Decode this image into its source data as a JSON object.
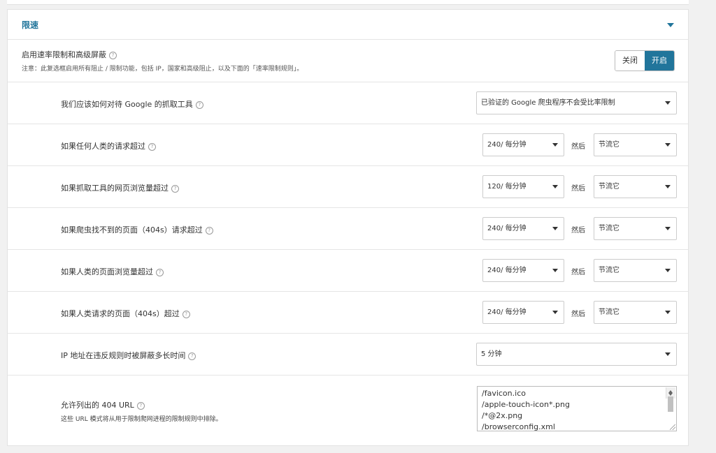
{
  "panel": {
    "title": "限速"
  },
  "master": {
    "label": "启用速率限制和高级屏蔽",
    "note": "注意：此复选框启用所有阻止 / 限制功能，包括 IP，国家和高级阻止，以及下面的「速率限制规则」。",
    "toggle_off": "关闭",
    "toggle_on": "开启",
    "state": "on"
  },
  "help_glyph": "?",
  "then_label": "然后",
  "rows": [
    {
      "label": "我们应该如何对待 Google 的抓取工具",
      "select": "已验证的 Google 爬虫程序不会受比率限制"
    },
    {
      "label": "如果任何人类的请求超过",
      "rate": "240/ 每分钟",
      "action": "节流它"
    },
    {
      "label": "如果抓取工具的网页浏览量超过",
      "rate": "120/ 每分钟",
      "action": "节流它"
    },
    {
      "label": "如果爬虫找不到的页面（404s）请求超过",
      "rate": "240/ 每分钟",
      "action": "节流它"
    },
    {
      "label": "如果人类的页面浏览量超过",
      "rate": "240/ 每分钟",
      "action": "节流它"
    },
    {
      "label": "如果人类请求的页面（404s）超过",
      "rate": "240/ 每分钟",
      "action": "节流它"
    },
    {
      "label": "IP 地址在违反规则时被屏蔽多长时间",
      "select": "5 分钟"
    }
  ],
  "allowed_404": {
    "label": "允许列出的 404 URL",
    "note": "这些 URL 模式将从用于限制爬网进程的限制规则中排除。",
    "lines": [
      "/favicon.ico",
      "/apple-touch-icon*.png",
      "/*@2x.png",
      "/browserconfig.xml"
    ]
  }
}
